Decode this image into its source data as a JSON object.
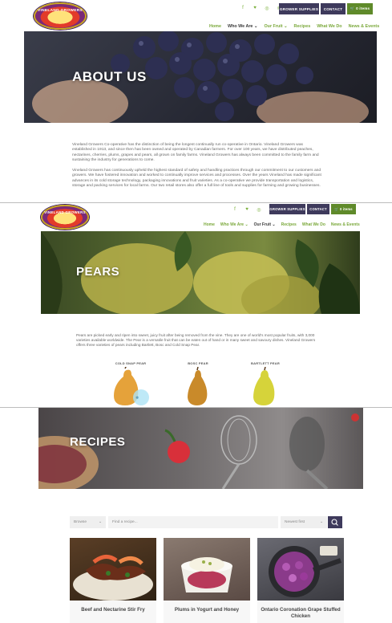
{
  "colors": {
    "accent_green": "#7aa83a",
    "button_purple": "#3e3a5c",
    "cart_green": "#5f8a2a"
  },
  "header": {
    "logo_text": "VINELAND GROWERS",
    "social_icons": [
      "facebook-icon",
      "twitter-icon",
      "instagram-icon",
      "rss-icon"
    ],
    "social_glyphs": [
      "f",
      "♥",
      "◎",
      "≋"
    ],
    "grower_supplies": "GROWER SUPPLIES",
    "contact": "CONTACT",
    "cart": "🛒 0 items",
    "nav": [
      "Home",
      "Who We Are ⌄",
      "Our Fruit ⌄",
      "Recipes",
      "What We Do",
      "News & Events"
    ]
  },
  "about": {
    "title": "ABOUT US",
    "p1": "Vineland Growers Co-operative has the distinction of being the longest continually run co-operative in Ontario. Vineland Growers was established in 1913, and since then has been owned and operated by Canadian farmers. For over 100 years, we have distributed peaches, nectarines, cherries, plums, grapes and pears, all grown on family farms. Vineland Growers has always been committed to the family farm and sustaining the industry for generations to come.",
    "p2": "Vineland Growers has continuously upheld the highest standard of safety and handling practices through our commitment to our customers and growers. We have fostered innovation and worked to continually improve services and processes. Over the years Vineland has made significant advances in its cold storage technology, packaging innovations and fruit varieties. As a co-operative we provide transportation and logistics, storage and packing services for local farms. Our two retail stores also offer a full line of tools and supplies for farming and growing businesses."
  },
  "pears": {
    "title": "PEARS",
    "p": "Pears are picked early and ripen into sweet, juicy fruit after being removed from the vine. They are one of world's most popular fruits, with 3,000 varieties available worldwide. The Pear is a versatile fruit that can be eaten out of hand or in many sweet and savoury dishes. Vineland Growers offers three varieties of pears including Bartlett, Bosc and Cold Snap Pear.",
    "varieties": [
      "COLD SNAP PEAR",
      "BOSC PEAR",
      "BARTLETT PEAR"
    ]
  },
  "recipes": {
    "title": "RECIPES",
    "browse": "Browse",
    "search_placeholder": "Find a recipe...",
    "sort": "Newest first",
    "cards": [
      "Beef and Nectarine Stir Fry",
      "Plums in Yogurt and Honey",
      "Ontario Coronation Grape Stuffed Chicken"
    ]
  }
}
